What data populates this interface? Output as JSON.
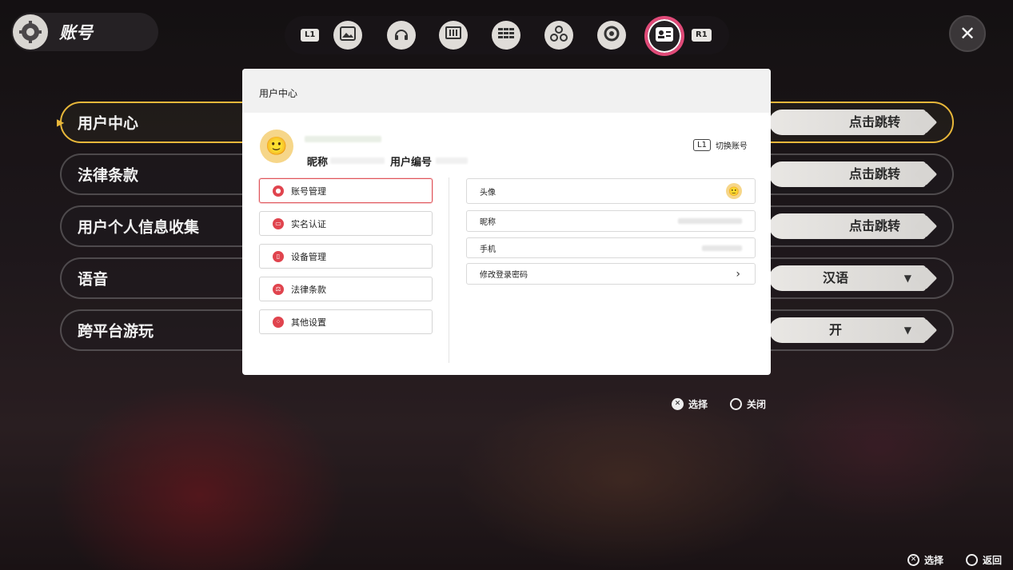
{
  "header": {
    "title": "账号"
  },
  "topnav": {
    "left_key": "L1",
    "right_key": "R1"
  },
  "menu": {
    "rows": [
      {
        "label": "用户中心",
        "value": "点击跳转"
      },
      {
        "label": "法律条款",
        "value": "点击跳转"
      },
      {
        "label": "用户个人信息收集",
        "value": "点击跳转"
      },
      {
        "label": "语音",
        "value": "汉语"
      },
      {
        "label": "跨平台游玩",
        "value": "开"
      }
    ]
  },
  "modal": {
    "title": "用户中心",
    "nickname_label": "昵称",
    "uid_label": "用户编号",
    "switch_key": "L1",
    "switch_label": "切换账号",
    "left_buttons": [
      "账号管理",
      "实名认证",
      "设备管理",
      "法律条款",
      "其他设置"
    ],
    "right_rows": [
      "头像",
      "昵称",
      "手机",
      "修改登录密码"
    ]
  },
  "hints": {
    "center_select": "选择",
    "center_close": "关闭",
    "bottom_select": "选择",
    "bottom_back": "返回"
  },
  "colors": {
    "accent_gold": "#e8b73a",
    "accent_pink": "#e04a78",
    "danger_red": "#e0444e"
  }
}
